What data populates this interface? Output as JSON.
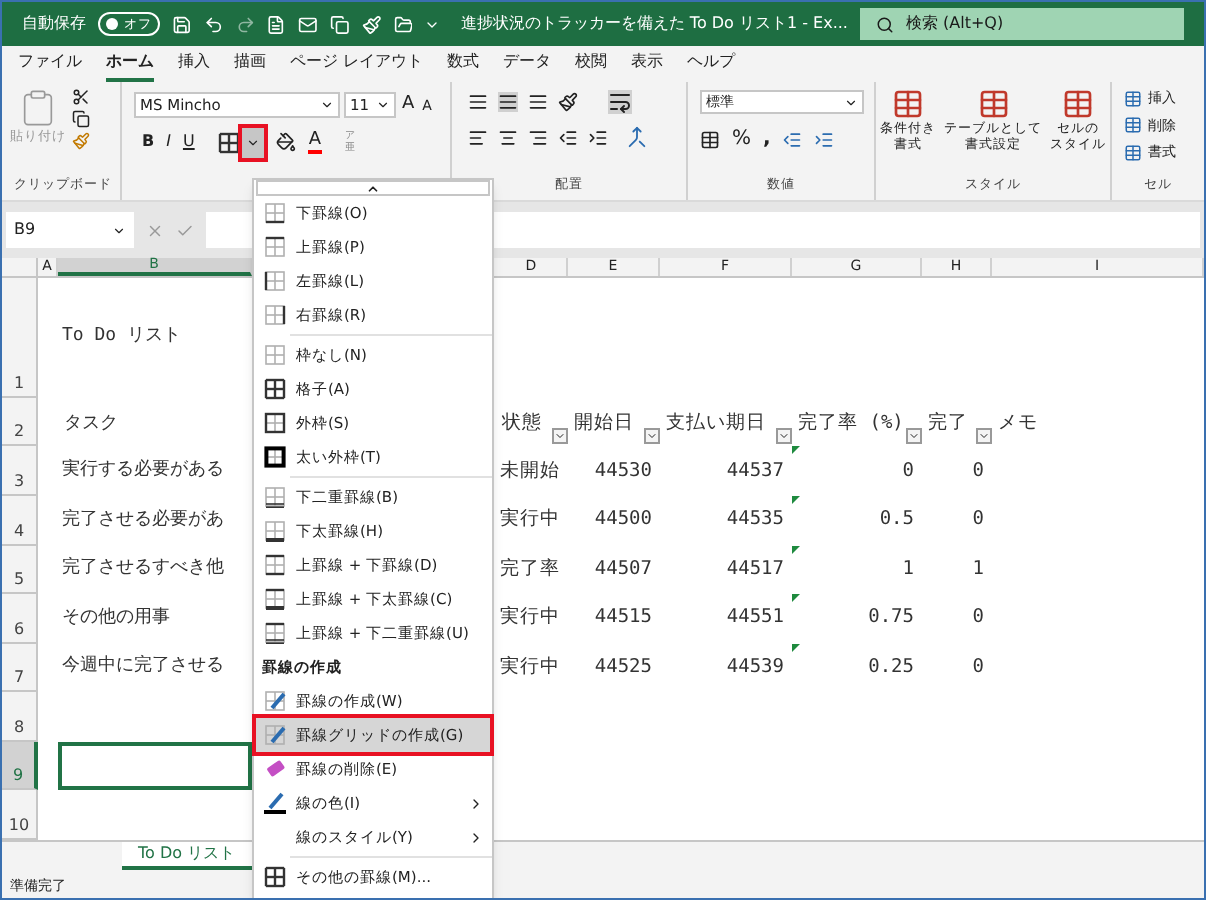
{
  "title_bar": {
    "autosave_label": "自動保存",
    "autosave": {
      "label": "オフ",
      "on": false
    },
    "title": "進捗状況のトラッカーを備えた To Do リスト1  -  Ex...",
    "search_placeholder": "検索 (Alt+Q)"
  },
  "menu_tabs": [
    {
      "label": "ファイル",
      "selected": false
    },
    {
      "label": "ホーム",
      "selected": true
    },
    {
      "label": "挿入",
      "selected": false
    },
    {
      "label": "描画",
      "selected": false
    },
    {
      "label": "ページ レイアウト",
      "selected": false
    },
    {
      "label": "数式",
      "selected": false
    },
    {
      "label": "データ",
      "selected": false
    },
    {
      "label": "校閲",
      "selected": false
    },
    {
      "label": "表示",
      "selected": false
    },
    {
      "label": "ヘルプ",
      "selected": false
    }
  ],
  "ribbon": {
    "clipboard": {
      "paste": "貼り付け",
      "group": "クリップボード"
    },
    "font": {
      "name": "MS Mincho",
      "size": "11",
      "grow": "A",
      "shrink": "A",
      "bold": "B",
      "italic": "I",
      "underline": "U",
      "color_letter": "A",
      "phonetic": [
        "ア",
        "亜"
      ],
      "borders_dropdown_highlighted": true
    },
    "alignment": {
      "group": "配置"
    },
    "number": {
      "format": "標準",
      "percent": "%",
      "comma": ",",
      "group": "数値"
    },
    "styles": {
      "buttons": [
        {
          "lines": [
            "条件付き",
            "書式"
          ]
        },
        {
          "lines": [
            "テーブルとして",
            "書式設定"
          ]
        },
        {
          "lines": [
            "セルの",
            "スタイル"
          ]
        }
      ],
      "group": "スタイル"
    },
    "cells": {
      "buttons": [
        "挿入",
        "削除",
        "書式"
      ],
      "group": "セル"
    }
  },
  "name_box": "B9",
  "columns": [
    {
      "label": "A",
      "selected": false
    },
    {
      "label": "B",
      "selected": true
    },
    {
      "label": "D",
      "selected": false
    },
    {
      "label": "E",
      "selected": false
    },
    {
      "label": "F",
      "selected": false
    },
    {
      "label": "G",
      "selected": false
    },
    {
      "label": "H",
      "selected": false
    },
    {
      "label": "I",
      "selected": false
    }
  ],
  "rows": [
    {
      "number": "1",
      "kind": "title",
      "selected": false,
      "b": "To Do リスト"
    },
    {
      "number": "2",
      "kind": "header",
      "selected": false,
      "b": "タスク",
      "d": "状態",
      "e": "開始日",
      "f": "支払い期日",
      "g": "完了率 (%)",
      "h": "完了",
      "i": "メモ"
    },
    {
      "number": "3",
      "kind": "data",
      "selected": false,
      "flag": true,
      "b": "実行する必要がある",
      "d": "未開始",
      "e": "44530",
      "f": "44537",
      "g": "0",
      "h": "0"
    },
    {
      "number": "4",
      "kind": "data",
      "selected": false,
      "flag": true,
      "b": "完了させる必要があ",
      "d": "実行中",
      "e": "44500",
      "f": "44535",
      "g": "0.5",
      "h": "0"
    },
    {
      "number": "5",
      "kind": "data",
      "selected": false,
      "flag": true,
      "b": "完了させるすべき他",
      "d": "完了率",
      "e": "44507",
      "f": "44517",
      "g": "1",
      "h": "1"
    },
    {
      "number": "6",
      "kind": "data",
      "selected": false,
      "flag": true,
      "b": "その他の用事",
      "d": "実行中",
      "e": "44515",
      "f": "44551",
      "g": "0.75",
      "h": "0"
    },
    {
      "number": "7",
      "kind": "data",
      "selected": false,
      "flag": true,
      "b": "今週中に完了させる",
      "d": "実行中",
      "e": "44525",
      "f": "44539",
      "g": "0.25",
      "h": "0"
    },
    {
      "number": "8",
      "kind": "empty",
      "selected": false
    },
    {
      "number": "9",
      "kind": "empty",
      "selected": true
    },
    {
      "number": "10",
      "kind": "empty",
      "selected": false
    }
  ],
  "sheet_tab": {
    "label": "To Do リスト",
    "selected": true
  },
  "status_bar": "準備完了",
  "borders_menu": [
    {
      "kind": "item",
      "label": "下罫線(O)",
      "selected": false
    },
    {
      "kind": "item",
      "label": "上罫線(P)",
      "selected": false
    },
    {
      "kind": "item",
      "label": "左罫線(L)",
      "selected": false
    },
    {
      "kind": "item",
      "label": "右罫線(R)",
      "selected": false
    },
    {
      "kind": "separator"
    },
    {
      "kind": "item",
      "label": "枠なし(N)",
      "selected": false
    },
    {
      "kind": "item",
      "label": "格子(A)",
      "selected": false
    },
    {
      "kind": "item",
      "label": "外枠(S)",
      "selected": false
    },
    {
      "kind": "item",
      "label": "太い外枠(T)",
      "selected": false
    },
    {
      "kind": "separator"
    },
    {
      "kind": "item",
      "label": "下二重罫線(B)",
      "selected": false
    },
    {
      "kind": "item",
      "label": "下太罫線(H)",
      "selected": false
    },
    {
      "kind": "item",
      "label": "上罫線 + 下罫線(D)",
      "selected": false
    },
    {
      "kind": "item",
      "label": "上罫線 + 下太罫線(C)",
      "selected": false
    },
    {
      "kind": "item",
      "label": "上罫線 + 下二重罫線(U)",
      "selected": false
    },
    {
      "kind": "header",
      "label": "罫線の作成"
    },
    {
      "kind": "item",
      "label": "罫線の作成(W)",
      "selected": false
    },
    {
      "kind": "item",
      "label": "罫線グリッドの作成(G)",
      "selected": true
    },
    {
      "kind": "item",
      "label": "罫線の削除(E)",
      "selected": false
    },
    {
      "kind": "item",
      "label": "線の色(I)",
      "selected": false,
      "submenu": true
    },
    {
      "kind": "item",
      "label": "線のスタイル(Y)",
      "selected": false,
      "submenu": true
    },
    {
      "kind": "separator"
    },
    {
      "kind": "item",
      "label": "その他の罫線(M)...",
      "selected": false
    }
  ]
}
